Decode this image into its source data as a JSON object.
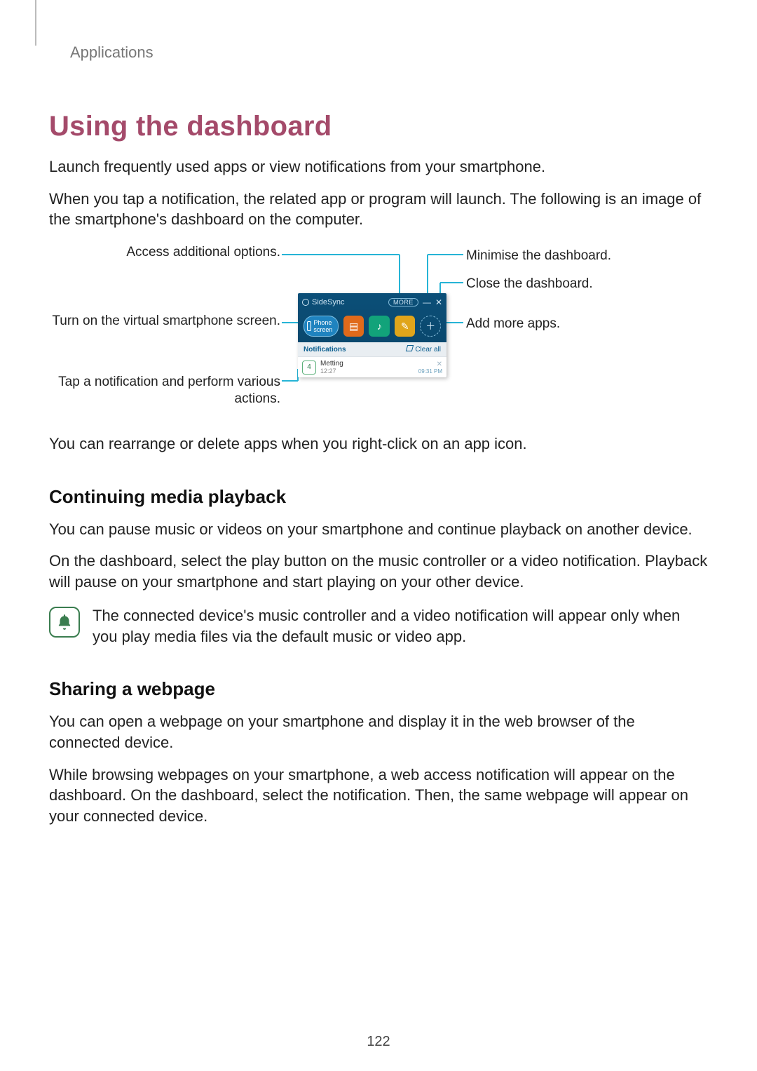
{
  "header": {
    "section": "Applications"
  },
  "title": "Using the dashboard",
  "intro": [
    "Launch frequently used apps or view notifications from your smartphone.",
    "When you tap a notification, the related app or program will launch. The following is an image of the smartphone's dashboard on the computer."
  ],
  "callouts": {
    "left1": "Access additional options.",
    "left2": "Turn on the virtual smartphone screen.",
    "left3": "Tap a notification and perform various actions.",
    "right1": "Minimise the dashboard.",
    "right2": "Close the dashboard.",
    "right3": "Add more apps."
  },
  "dashboard": {
    "brand": "SideSync",
    "more": "MORE",
    "phone_label": "Phone screen",
    "notifications_label": "Notifications",
    "clear_all": "Clear all",
    "notif_title": "Metting",
    "notif_sub": "12:27",
    "notif_day": "4",
    "notif_time": "09:31 PM"
  },
  "after_diagram": "You can rearrange or delete apps when you right-click on an app icon.",
  "s1": {
    "title": "Continuing media playback",
    "p1": "You can pause music or videos on your smartphone and continue playback on another device.",
    "p2": "On the dashboard, select the play button on the music controller or a video notification. Playback will pause on your smartphone and start playing on your other device.",
    "note": "The connected device's music controller and a video notification will appear only when you play media files via the default music or video app."
  },
  "s2": {
    "title": "Sharing a webpage",
    "p1": "You can open a webpage on your smartphone and display it in the web browser of the connected device.",
    "p2": "While browsing webpages on your smartphone, a web access notification will appear on the dashboard. On the dashboard, select the notification. Then, the same webpage will appear on your connected device."
  },
  "page_number": "122"
}
